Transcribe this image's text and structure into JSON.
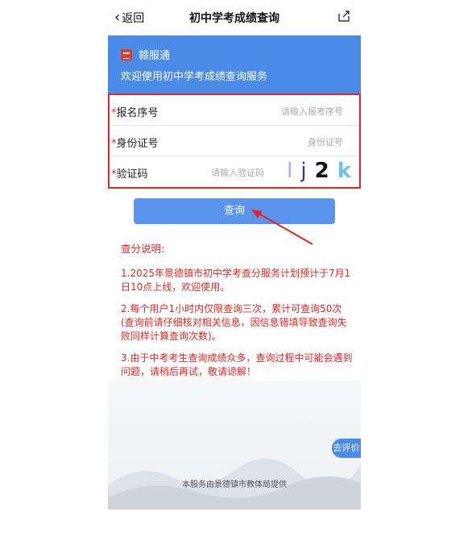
{
  "nav": {
    "back_label": "返回",
    "title": "初中学考成绩查询",
    "icon": "share-icon"
  },
  "banner": {
    "brand": "赣服通",
    "welcome": "欢迎使用初中学考成绩查询服务",
    "brand_color": "#4a8be8"
  },
  "form": {
    "fields": [
      {
        "label": "报名序号",
        "placeholder": "请输入报考序号"
      },
      {
        "label": "身份证号",
        "placeholder": "身份证号"
      },
      {
        "label": "验证码",
        "placeholder": "请输入验证码"
      }
    ],
    "required_mark": "*",
    "captcha": [
      "l",
      "j",
      "2",
      "k"
    ],
    "captcha_colors": [
      "#b9a6e6",
      "#4b2c8c",
      "#111111",
      "#6fc3e8"
    ],
    "highlight_color": "#e8251f"
  },
  "query_button": {
    "label": "查询"
  },
  "notes": {
    "title": "查分说明:",
    "items": [
      "1.2025年景德镇市初中学考查分服务计划预计于7月1日10点上线，欢迎使用。",
      "2.每个用户1小时内仅限查询三次，累计可查询50次(查询前请仔细核对相关信息，因信息错填导致查询失败同样计算查询次数)。",
      "3.由于中考考生查询成绩众多，查询过程中可能会遇到问题，请稍后再试，敬请谅解！"
    ],
    "color": "#e8251f"
  },
  "rate_button": {
    "label": "去评价"
  },
  "footer": {
    "text": "本服务由景德镇市教体局提供"
  }
}
